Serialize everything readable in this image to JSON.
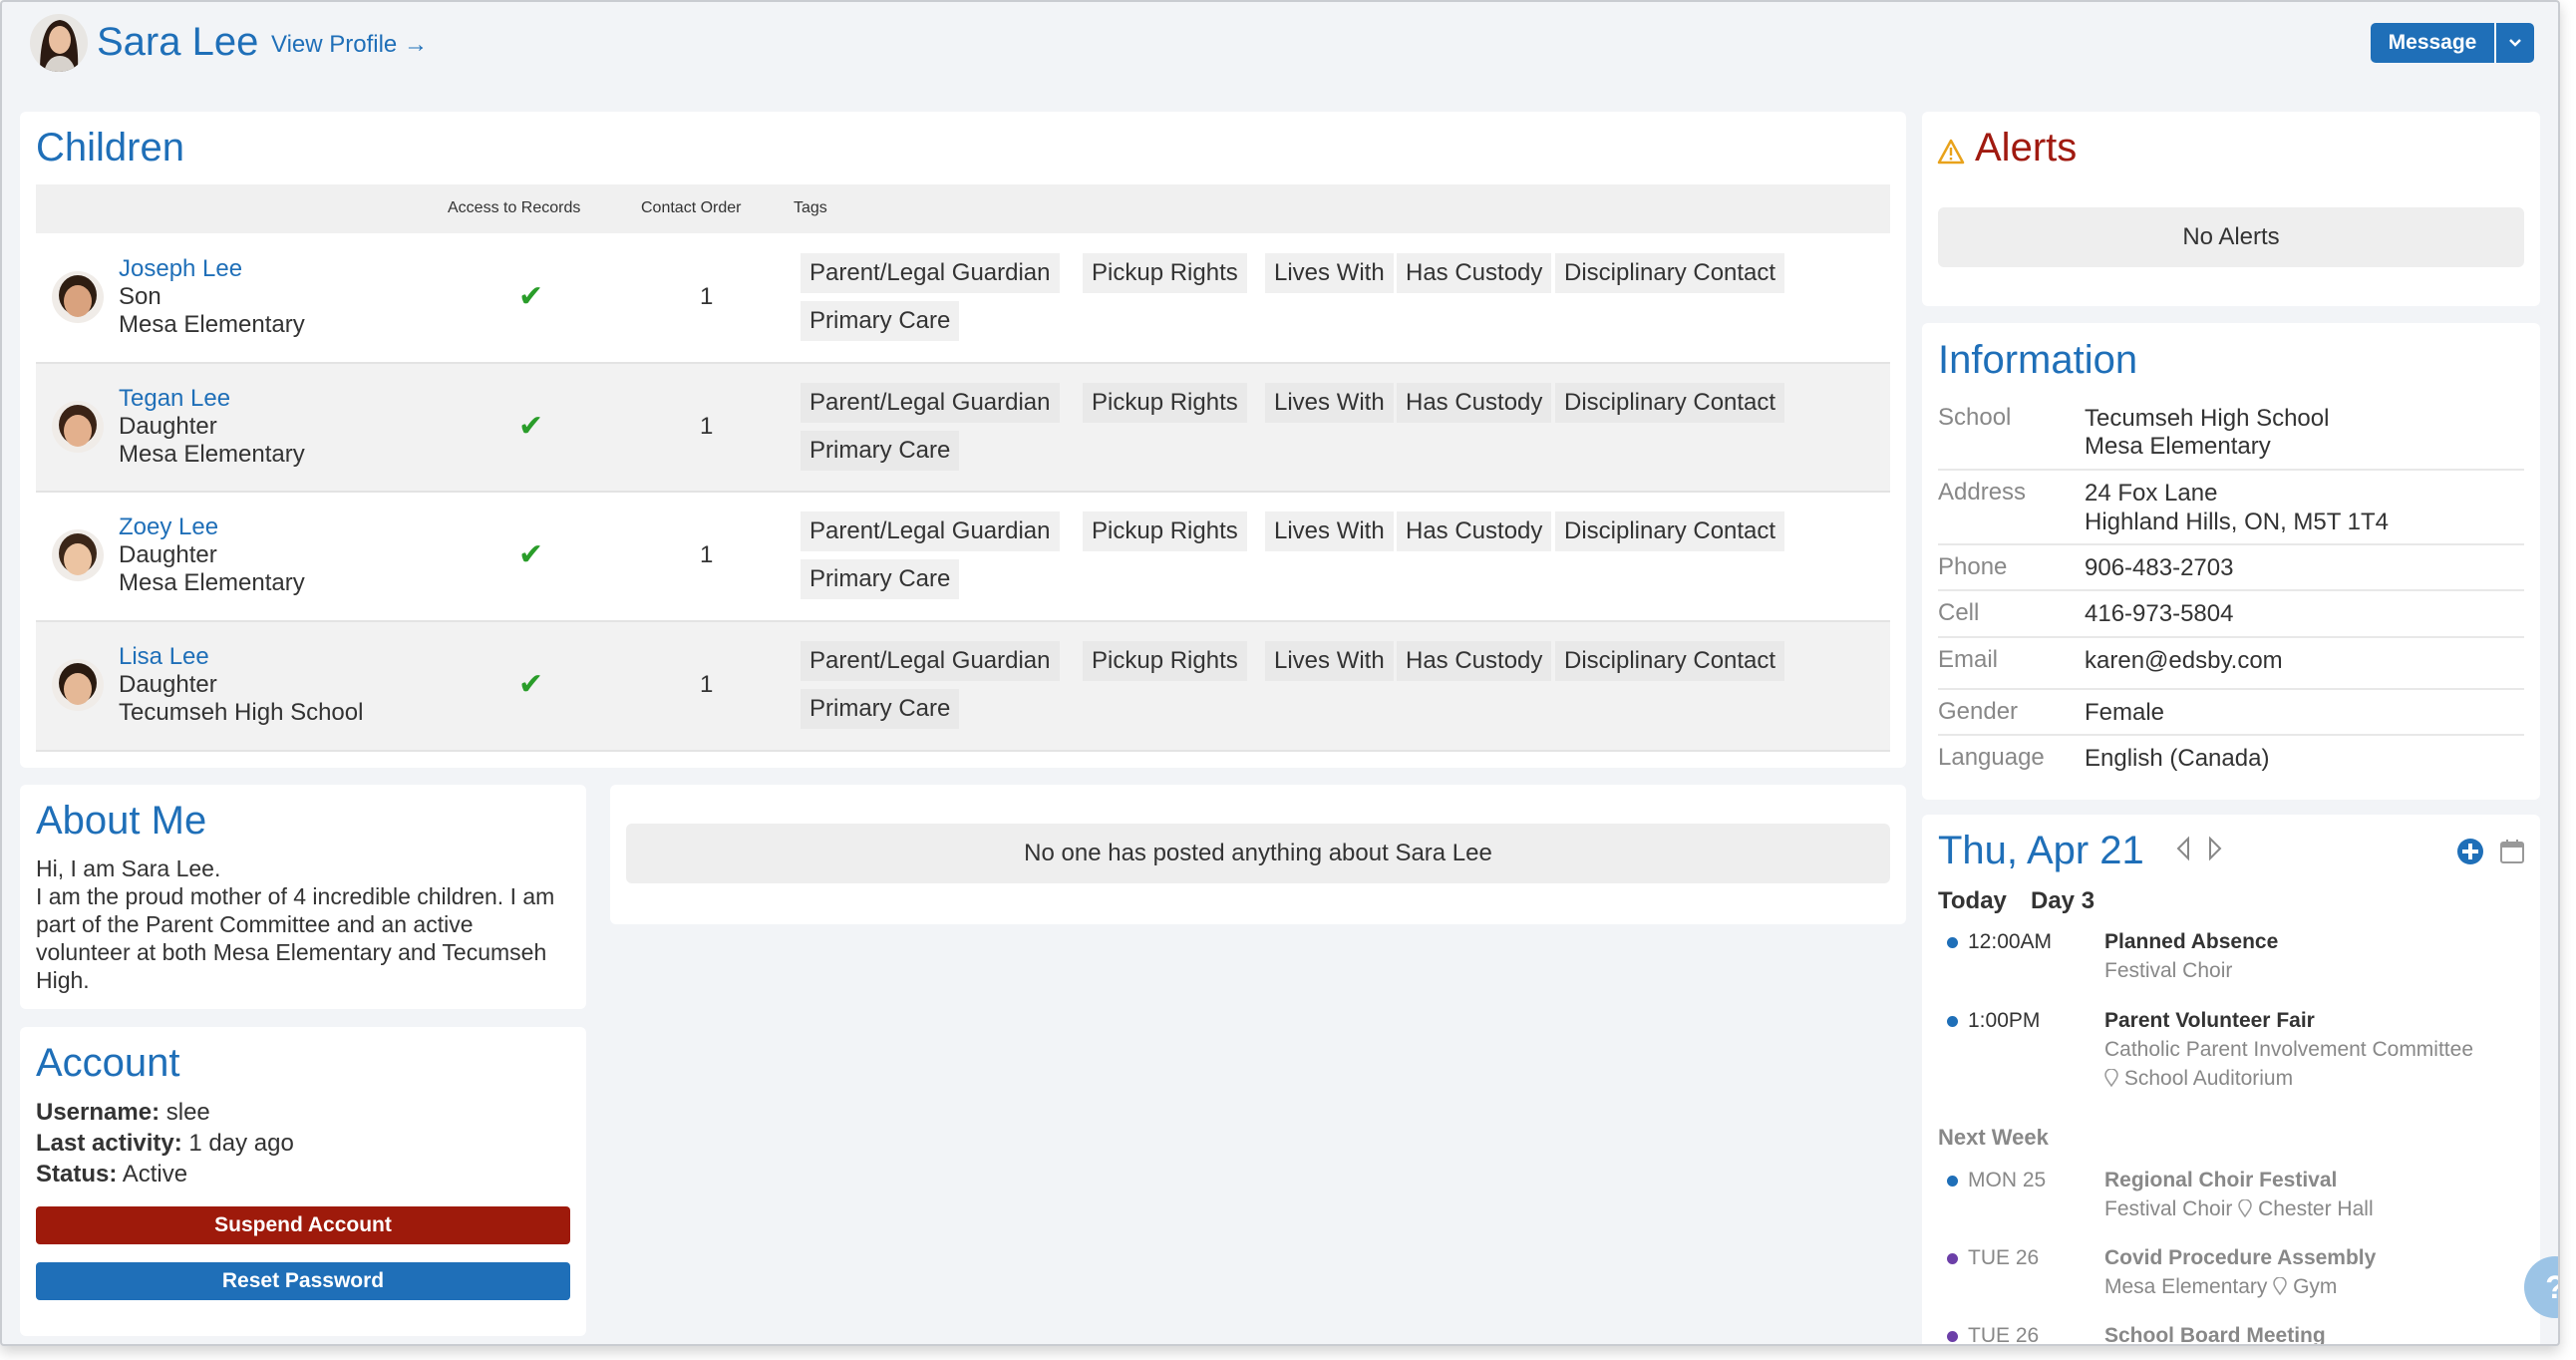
{
  "header": {
    "name": "Sara Lee",
    "view_profile": "View Profile →",
    "message_label": "Message"
  },
  "children": {
    "title": "Children",
    "columns": [
      "Access to Records",
      "Contact Order",
      "Tags"
    ],
    "rows": [
      {
        "name": "Joseph Lee",
        "relation": "Son",
        "school": "Mesa Elementary",
        "access": "✔",
        "order": "1",
        "tags": [
          "Parent/Legal Guardian",
          "Pickup Rights",
          "Lives With",
          "Has Custody",
          "Disciplinary Contact",
          "Primary Care"
        ]
      },
      {
        "name": "Tegan Lee",
        "relation": "Daughter",
        "school": "Mesa Elementary",
        "access": "✔",
        "order": "1",
        "tags": [
          "Parent/Legal Guardian",
          "Pickup Rights",
          "Lives With",
          "Has Custody",
          "Disciplinary Contact",
          "Primary Care"
        ]
      },
      {
        "name": "Zoey Lee",
        "relation": "Daughter",
        "school": "Mesa Elementary",
        "access": "✔",
        "order": "1",
        "tags": [
          "Parent/Legal Guardian",
          "Pickup Rights",
          "Lives With",
          "Has Custody",
          "Disciplinary Contact",
          "Primary Care"
        ]
      },
      {
        "name": "Lisa Lee",
        "relation": "Daughter",
        "school": "Tecumseh High School",
        "access": "✔",
        "order": "1",
        "tags": [
          "Parent/Legal Guardian",
          "Pickup Rights",
          "Lives With",
          "Has Custody",
          "Disciplinary Contact",
          "Primary Care"
        ]
      }
    ]
  },
  "alerts": {
    "title": "Alerts",
    "empty": "No Alerts"
  },
  "information": {
    "title": "Information",
    "school_label": "School",
    "school_1": "Tecumseh High School",
    "school_2": "Mesa Elementary",
    "address_label": "Address",
    "address_1": "24 Fox Lane",
    "address_2": "Highland Hills, ON, M5T 1T4",
    "phone_label": "Phone",
    "phone": "906-483-2703",
    "cell_label": "Cell",
    "cell": "416-973-5804",
    "email_label": "Email",
    "email": "karen@edsby.com",
    "gender_label": "Gender",
    "gender": "Female",
    "language_label": "Language",
    "language": "English (Canada)"
  },
  "about": {
    "title": "About Me",
    "line1": "Hi, I am Sara Lee.",
    "line2": "I am the proud mother of 4 incredible children. I am part of the Parent Committee and an active volunteer at both Mesa Elementary and Tecumseh High."
  },
  "posts": {
    "empty": "No one has posted anything about Sara Lee"
  },
  "account": {
    "title": "Account",
    "username_label": "Username:",
    "username": "slee",
    "activity_label": "Last activity:",
    "activity": "1 day ago",
    "status_label": "Status:",
    "status": "Active",
    "suspend_label": "Suspend Account",
    "reset_label": "Reset Password"
  },
  "calendar": {
    "date": "Thu, Apr 21",
    "today": "Today",
    "day": "Day 3",
    "next_week": "Next Week",
    "today_events": [
      {
        "time": "12:00AM",
        "title": "Planned Absence",
        "sub": "Festival Choir",
        "loc": ""
      },
      {
        "time": "1:00PM",
        "title": "Parent Volunteer Fair",
        "sub": "Catholic Parent Involvement Committee",
        "loc": "School Auditorium"
      }
    ],
    "week_events": [
      {
        "time": "MON 25",
        "title": "Regional Choir Festival",
        "sub": "Festival Choir",
        "loc": "Chester Hall"
      },
      {
        "time": "TUE 26",
        "title": "Covid Procedure Assembly",
        "sub": "Mesa Elementary",
        "loc": "Gym"
      },
      {
        "time": "TUE 26",
        "title": "School Board Meeting",
        "sub": "",
        "loc": ""
      }
    ]
  },
  "colors": {
    "accent": "#1f6fb8",
    "danger": "#9e1a0b",
    "check": "#2a9d2a",
    "alert": "#a01a10"
  }
}
